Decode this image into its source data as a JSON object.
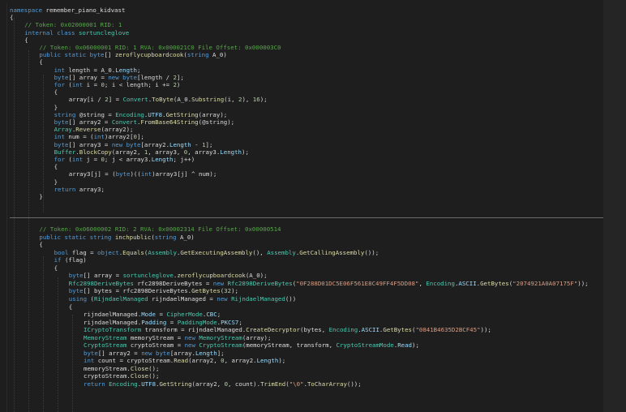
{
  "colors": {
    "background": "#1e1e1e",
    "comment": "#57a64a",
    "keyword": "#569cd6",
    "type": "#4ec9b0",
    "method": "#dcdcaa",
    "string": "#d69d85",
    "number": "#b5cea8",
    "property": "#9cdcfe",
    "plain": "#dcdcdc"
  },
  "code_lines": [
    {
      "indent": 0,
      "tokens": [
        [
          "k",
          "namespace "
        ],
        [
          "pl",
          "remember_piano_kidvast"
        ]
      ]
    },
    {
      "indent": 0,
      "tokens": [
        [
          "pl",
          "{"
        ]
      ]
    },
    {
      "indent": 1,
      "tokens": [
        [
          "c",
          "// Token: 0x02000001 RID: 1"
        ]
      ]
    },
    {
      "indent": 1,
      "tokens": [
        [
          "k",
          "internal class "
        ],
        [
          "t",
          "sortuncleglove"
        ]
      ]
    },
    {
      "indent": 1,
      "tokens": [
        [
          "pl",
          "{"
        ]
      ]
    },
    {
      "indent": 2,
      "tokens": [
        [
          "c",
          "// Token: 0x06000001 RID: 1 RVA: 0x000021C0 File Offset: 0x000003C0"
        ]
      ]
    },
    {
      "indent": 2,
      "tokens": [
        [
          "k",
          "public static byte"
        ],
        [
          "pl",
          "[] "
        ],
        [
          "m",
          "zeroflycupboardcook"
        ],
        [
          "pl",
          "("
        ],
        [
          "k",
          "string"
        ],
        [
          "pl",
          " A_0)"
        ]
      ]
    },
    {
      "indent": 2,
      "tokens": [
        [
          "pl",
          "{"
        ]
      ]
    },
    {
      "indent": 3,
      "tokens": [
        [
          "k",
          "int"
        ],
        [
          "pl",
          " length = A_0."
        ],
        [
          "p",
          "Length"
        ],
        [
          "pl",
          ";"
        ]
      ]
    },
    {
      "indent": 3,
      "tokens": [
        [
          "k",
          "byte"
        ],
        [
          "pl",
          "[] array = "
        ],
        [
          "k",
          "new byte"
        ],
        [
          "pl",
          "[length / "
        ],
        [
          "n",
          "2"
        ],
        [
          "pl",
          "];"
        ]
      ]
    },
    {
      "indent": 3,
      "tokens": [
        [
          "k",
          "for"
        ],
        [
          "pl",
          " ("
        ],
        [
          "k",
          "int"
        ],
        [
          "pl",
          " i = "
        ],
        [
          "n",
          "0"
        ],
        [
          "pl",
          "; i < length; i += "
        ],
        [
          "n",
          "2"
        ],
        [
          "pl",
          ")"
        ]
      ]
    },
    {
      "indent": 3,
      "tokens": [
        [
          "pl",
          "{"
        ]
      ]
    },
    {
      "indent": 4,
      "tokens": [
        [
          "pl",
          "array[i / "
        ],
        [
          "n",
          "2"
        ],
        [
          "pl",
          "] = "
        ],
        [
          "t",
          "Convert"
        ],
        [
          "pl",
          "."
        ],
        [
          "m",
          "ToByte"
        ],
        [
          "pl",
          "(A_0."
        ],
        [
          "m",
          "Substring"
        ],
        [
          "pl",
          "(i, "
        ],
        [
          "n",
          "2"
        ],
        [
          "pl",
          "), "
        ],
        [
          "n",
          "16"
        ],
        [
          "pl",
          ");"
        ]
      ]
    },
    {
      "indent": 3,
      "tokens": [
        [
          "pl",
          "}"
        ]
      ]
    },
    {
      "indent": 3,
      "tokens": [
        [
          "k",
          "string"
        ],
        [
          "pl",
          " @string = "
        ],
        [
          "t",
          "Encoding"
        ],
        [
          "pl",
          "."
        ],
        [
          "p",
          "UTF8"
        ],
        [
          "pl",
          "."
        ],
        [
          "m",
          "GetString"
        ],
        [
          "pl",
          "(array);"
        ]
      ]
    },
    {
      "indent": 3,
      "tokens": [
        [
          "k",
          "byte"
        ],
        [
          "pl",
          "[] array2 = "
        ],
        [
          "t",
          "Convert"
        ],
        [
          "pl",
          "."
        ],
        [
          "m",
          "FromBase64String"
        ],
        [
          "pl",
          "(@string);"
        ]
      ]
    },
    {
      "indent": 3,
      "tokens": [
        [
          "t",
          "Array"
        ],
        [
          "pl",
          "."
        ],
        [
          "m",
          "Reverse"
        ],
        [
          "pl",
          "(array2);"
        ]
      ]
    },
    {
      "indent": 3,
      "tokens": [
        [
          "k",
          "int"
        ],
        [
          "pl",
          " num = ("
        ],
        [
          "k",
          "int"
        ],
        [
          "pl",
          ")array2["
        ],
        [
          "n",
          "0"
        ],
        [
          "pl",
          "];"
        ]
      ]
    },
    {
      "indent": 3,
      "tokens": [
        [
          "k",
          "byte"
        ],
        [
          "pl",
          "[] array3 = "
        ],
        [
          "k",
          "new byte"
        ],
        [
          "pl",
          "[array2."
        ],
        [
          "p",
          "Length"
        ],
        [
          "pl",
          " - "
        ],
        [
          "n",
          "1"
        ],
        [
          "pl",
          "];"
        ]
      ]
    },
    {
      "indent": 3,
      "tokens": [
        [
          "t",
          "Buffer"
        ],
        [
          "pl",
          "."
        ],
        [
          "m",
          "BlockCopy"
        ],
        [
          "pl",
          "(array2, "
        ],
        [
          "n",
          "1"
        ],
        [
          "pl",
          ", array3, "
        ],
        [
          "n",
          "0"
        ],
        [
          "pl",
          ", array3."
        ],
        [
          "p",
          "Length"
        ],
        [
          "pl",
          ");"
        ]
      ]
    },
    {
      "indent": 3,
      "tokens": [
        [
          "k",
          "for"
        ],
        [
          "pl",
          " ("
        ],
        [
          "k",
          "int"
        ],
        [
          "pl",
          " j = "
        ],
        [
          "n",
          "0"
        ],
        [
          "pl",
          "; j < array3."
        ],
        [
          "p",
          "Length"
        ],
        [
          "pl",
          "; j++)"
        ]
      ]
    },
    {
      "indent": 3,
      "tokens": [
        [
          "pl",
          "{"
        ]
      ]
    },
    {
      "indent": 4,
      "tokens": [
        [
          "pl",
          "array3[j] = ("
        ],
        [
          "k",
          "byte"
        ],
        [
          "pl",
          ")(("
        ],
        [
          "k",
          "int"
        ],
        [
          "pl",
          ")array3[j] ^ num);"
        ]
      ]
    },
    {
      "indent": 3,
      "tokens": [
        [
          "pl",
          "}"
        ]
      ]
    },
    {
      "indent": 3,
      "tokens": [
        [
          "k",
          "return"
        ],
        [
          "pl",
          " array3;"
        ]
      ]
    },
    {
      "indent": 2,
      "tokens": [
        [
          "pl",
          "}"
        ]
      ]
    },
    {
      "indent": 2,
      "tokens": [
        [
          "c",
          "// Token: 0x06000002 RID: 2 RVA: 0x00002314 File Offset: 0x00000514"
        ]
      ]
    },
    {
      "indent": 2,
      "tokens": [
        [
          "k",
          "public static string "
        ],
        [
          "m",
          "inchpublic"
        ],
        [
          "pl",
          "("
        ],
        [
          "k",
          "string"
        ],
        [
          "pl",
          " A_0)"
        ]
      ]
    },
    {
      "indent": 2,
      "tokens": [
        [
          "pl",
          "{"
        ]
      ]
    },
    {
      "indent": 3,
      "tokens": [
        [
          "k",
          "bool"
        ],
        [
          "pl",
          " flag = "
        ],
        [
          "k",
          "object"
        ],
        [
          "pl",
          "."
        ],
        [
          "m",
          "Equals"
        ],
        [
          "pl",
          "("
        ],
        [
          "t",
          "Assembly"
        ],
        [
          "pl",
          "."
        ],
        [
          "m",
          "GetExecutingAssembly"
        ],
        [
          "pl",
          "(), "
        ],
        [
          "t",
          "Assembly"
        ],
        [
          "pl",
          "."
        ],
        [
          "m",
          "GetCallingAssembly"
        ],
        [
          "pl",
          "());"
        ]
      ]
    },
    {
      "indent": 3,
      "tokens": [
        [
          "k",
          "if"
        ],
        [
          "pl",
          " (flag)"
        ]
      ]
    },
    {
      "indent": 3,
      "tokens": [
        [
          "pl",
          "{"
        ]
      ]
    },
    {
      "indent": 4,
      "tokens": [
        [
          "k",
          "byte"
        ],
        [
          "pl",
          "[] array = "
        ],
        [
          "t",
          "sortuncleglove"
        ],
        [
          "pl",
          "."
        ],
        [
          "m",
          "zeroflycupboardcook"
        ],
        [
          "pl",
          "(A_0);"
        ]
      ]
    },
    {
      "indent": 4,
      "tokens": [
        [
          "t",
          "Rfc2898DeriveBytes"
        ],
        [
          "pl",
          " rfc2898DeriveBytes = "
        ],
        [
          "k",
          "new "
        ],
        [
          "t",
          "Rfc2898DeriveBytes"
        ],
        [
          "pl",
          "("
        ],
        [
          "s",
          "\"0F288D01DC5E06F561E8C49FF4F5DD08\""
        ],
        [
          "pl",
          ", "
        ],
        [
          "t",
          "Encoding"
        ],
        [
          "pl",
          "."
        ],
        [
          "p",
          "ASCII"
        ],
        [
          "pl",
          "."
        ],
        [
          "m",
          "GetBytes"
        ],
        [
          "pl",
          "("
        ],
        [
          "s",
          "\"2074921A0A07175F\""
        ],
        [
          "pl",
          "));"
        ]
      ]
    },
    {
      "indent": 4,
      "tokens": [
        [
          "k",
          "byte"
        ],
        [
          "pl",
          "[] bytes = rfc2898DeriveBytes."
        ],
        [
          "m",
          "GetBytes"
        ],
        [
          "pl",
          "("
        ],
        [
          "n",
          "32"
        ],
        [
          "pl",
          ");"
        ]
      ]
    },
    {
      "indent": 4,
      "tokens": [
        [
          "k",
          "using"
        ],
        [
          "pl",
          " ("
        ],
        [
          "t",
          "RijndaelManaged"
        ],
        [
          "pl",
          " rijndaelManaged = "
        ],
        [
          "k",
          "new "
        ],
        [
          "t",
          "RijndaelManaged"
        ],
        [
          "pl",
          "())"
        ]
      ]
    },
    {
      "indent": 4,
      "tokens": [
        [
          "pl",
          "{"
        ]
      ]
    },
    {
      "indent": 5,
      "tokens": [
        [
          "pl",
          "rijndaelManaged."
        ],
        [
          "p",
          "Mode"
        ],
        [
          "pl",
          " = "
        ],
        [
          "t",
          "CipherMode"
        ],
        [
          "pl",
          "."
        ],
        [
          "p",
          "CBC"
        ],
        [
          "pl",
          ";"
        ]
      ]
    },
    {
      "indent": 5,
      "tokens": [
        [
          "pl",
          "rijndaelManaged."
        ],
        [
          "p",
          "Padding"
        ],
        [
          "pl",
          " = "
        ],
        [
          "t",
          "PaddingMode"
        ],
        [
          "pl",
          "."
        ],
        [
          "p",
          "PKCS7"
        ],
        [
          "pl",
          ";"
        ]
      ]
    },
    {
      "indent": 5,
      "tokens": [
        [
          "t",
          "ICryptoTransform"
        ],
        [
          "pl",
          " transform = rijndaelManaged."
        ],
        [
          "m",
          "CreateDecryptor"
        ],
        [
          "pl",
          "(bytes, "
        ],
        [
          "t",
          "Encoding"
        ],
        [
          "pl",
          "."
        ],
        [
          "p",
          "ASCII"
        ],
        [
          "pl",
          "."
        ],
        [
          "m",
          "GetBytes"
        ],
        [
          "pl",
          "("
        ],
        [
          "s",
          "\"0841B4635D2BCF45\""
        ],
        [
          "pl",
          "));"
        ]
      ]
    },
    {
      "indent": 5,
      "tokens": [
        [
          "t",
          "MemoryStream"
        ],
        [
          "pl",
          " memoryStream = "
        ],
        [
          "k",
          "new "
        ],
        [
          "t",
          "MemoryStream"
        ],
        [
          "pl",
          "(array);"
        ]
      ]
    },
    {
      "indent": 5,
      "tokens": [
        [
          "t",
          "CryptoStream"
        ],
        [
          "pl",
          " cryptoStream = "
        ],
        [
          "k",
          "new "
        ],
        [
          "t",
          "CryptoStream"
        ],
        [
          "pl",
          "(memoryStream, transform, "
        ],
        [
          "t",
          "CryptoStreamMode"
        ],
        [
          "pl",
          "."
        ],
        [
          "p",
          "Read"
        ],
        [
          "pl",
          ");"
        ]
      ]
    },
    {
      "indent": 5,
      "tokens": [
        [
          "k",
          "byte"
        ],
        [
          "pl",
          "[] array2 = "
        ],
        [
          "k",
          "new byte"
        ],
        [
          "pl",
          "[array."
        ],
        [
          "p",
          "Length"
        ],
        [
          "pl",
          "];"
        ]
      ]
    },
    {
      "indent": 5,
      "tokens": [
        [
          "k",
          "int"
        ],
        [
          "pl",
          " count = cryptoStream."
        ],
        [
          "m",
          "Read"
        ],
        [
          "pl",
          "(array2, "
        ],
        [
          "n",
          "0"
        ],
        [
          "pl",
          ", array2."
        ],
        [
          "p",
          "Length"
        ],
        [
          "pl",
          ");"
        ]
      ]
    },
    {
      "indent": 5,
      "tokens": [
        [
          "pl",
          "memoryStream."
        ],
        [
          "m",
          "Close"
        ],
        [
          "pl",
          "();"
        ]
      ]
    },
    {
      "indent": 5,
      "tokens": [
        [
          "pl",
          "cryptoStream."
        ],
        [
          "m",
          "Close"
        ],
        [
          "pl",
          "();"
        ]
      ]
    },
    {
      "indent": 5,
      "tokens": [
        [
          "k",
          "return "
        ],
        [
          "t",
          "Encoding"
        ],
        [
          "pl",
          "."
        ],
        [
          "p",
          "UTF8"
        ],
        [
          "pl",
          "."
        ],
        [
          "m",
          "GetString"
        ],
        [
          "pl",
          "(array2, "
        ],
        [
          "n",
          "0"
        ],
        [
          "pl",
          ", count)."
        ],
        [
          "m",
          "TrimEnd"
        ],
        [
          "pl",
          "("
        ],
        [
          "s",
          "\"\\0\""
        ],
        [
          "pl",
          "."
        ],
        [
          "m",
          "ToCharArray"
        ],
        [
          "pl",
          "());"
        ]
      ]
    }
  ]
}
